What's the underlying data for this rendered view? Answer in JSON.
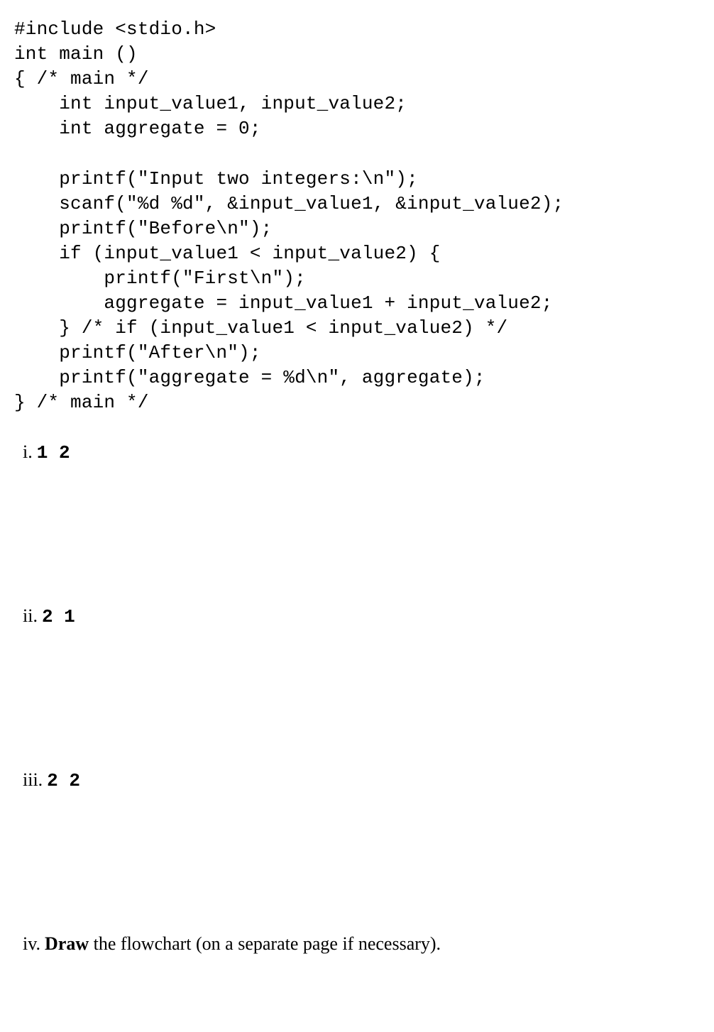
{
  "code": {
    "line1": "#include <stdio.h>",
    "line2": "int main ()",
    "line3": "{ /* main */",
    "line4": "    int input_value1, input_value2;",
    "line5": "    int aggregate = 0;",
    "line6": "",
    "line7": "    printf(\"Input two integers:\\n\");",
    "line8": "    scanf(\"%d %d\", &input_value1, &input_value2);",
    "line9": "    printf(\"Before\\n\");",
    "line10": "    if (input_value1 < input_value2) {",
    "line11": "        printf(\"First\\n\");",
    "line12": "        aggregate = input_value1 + input_value2;",
    "line13": "    } /* if (input_value1 < input_value2) */",
    "line14": "    printf(\"After\\n\");",
    "line15": "    printf(\"aggregate = %d\\n\", aggregate);",
    "line16": "} /* main */"
  },
  "questions": {
    "i": {
      "numeral": "i.",
      "input": "1 2"
    },
    "ii": {
      "numeral": "ii.",
      "input": "2 1"
    },
    "iii": {
      "numeral": "iii.",
      "input": "2 2"
    },
    "iv": {
      "numeral": "iv.",
      "bold": "Draw",
      "rest": " the flowchart (on a separate page if necessary)."
    }
  }
}
